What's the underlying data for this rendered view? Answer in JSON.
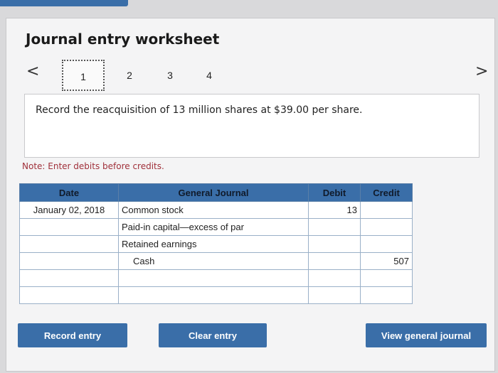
{
  "worksheet": {
    "title": "Journal entry worksheet",
    "steps": [
      "1",
      "2",
      "3",
      "4"
    ],
    "active_step": "1",
    "prev_icon": "<",
    "next_icon": ">"
  },
  "prompt": {
    "text": "Record the reacquisition of 13 million shares at $39.00 per share."
  },
  "note": "Note: Enter debits before credits.",
  "journal": {
    "headers": {
      "date": "Date",
      "account": "General Journal",
      "debit": "Debit",
      "credit": "Credit"
    },
    "rows": [
      {
        "date": "January 02, 2018",
        "account": "Common stock",
        "debit": "13",
        "credit": ""
      },
      {
        "date": "",
        "account": "Paid-in capital—excess of par",
        "debit": "",
        "credit": ""
      },
      {
        "date": "",
        "account": "Retained earnings",
        "debit": "",
        "credit": ""
      },
      {
        "date": "",
        "account": "Cash",
        "debit": "",
        "credit": "507"
      },
      {
        "date": "",
        "account": "",
        "debit": "",
        "credit": ""
      },
      {
        "date": "",
        "account": "",
        "debit": "",
        "credit": ""
      }
    ]
  },
  "buttons": {
    "record": "Record entry",
    "clear": "Clear entry",
    "view": "View general journal"
  },
  "colors": {
    "accent": "#3a6ea8",
    "note": "#a0303a"
  }
}
